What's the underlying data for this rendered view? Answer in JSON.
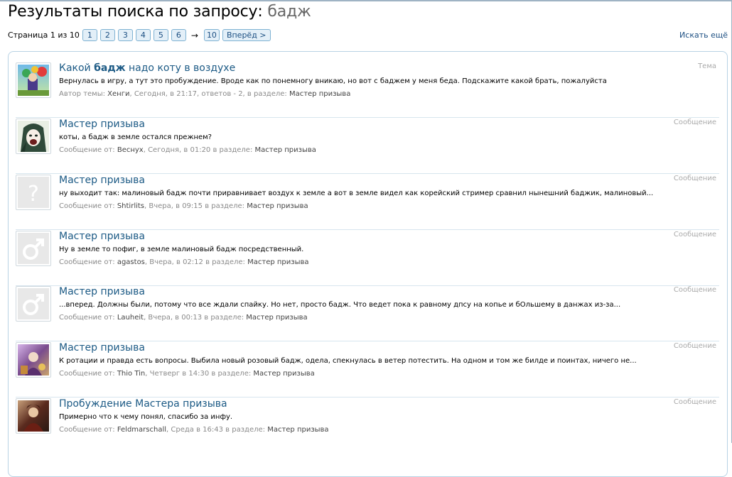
{
  "title": {
    "prefix": "Результаты поиска по запросу: ",
    "query": "бадж"
  },
  "pagination": {
    "info": "Страница 1 из 10",
    "pages": [
      "1",
      "2",
      "3",
      "4",
      "5",
      "6"
    ],
    "arrow": "→",
    "last": "10",
    "next": "Вперёд >"
  },
  "search_more": "Искать ещё",
  "results": [
    {
      "title_pre": "Какой ",
      "title_bold": "бадж",
      "title_post": " надо коту в воздухе",
      "snippet": "Вернулась в игру, а тут это пробуждение. Вроде как по понемногу вникаю, но вот с баджем у меня беда. Подскажите какой брать, пожалуйста",
      "meta_label": "Автор темы: ",
      "author": "Хенги",
      "meta_mid": ", Сегодня, в 21:17, ответов - 2, в разделе: ",
      "forum": "Мастер призыва",
      "type": "Тема",
      "avatar": "colorful-game-avatar"
    },
    {
      "title_pre": "Мастер призыва",
      "title_bold": "",
      "title_post": "",
      "snippet": "коты, а бадж в земле остался прежнем?",
      "meta_label": "Сообщение от: ",
      "author": "Веснух",
      "meta_mid": ", Сегодня, в 01:20 в разделе: ",
      "forum": "Мастер призыва",
      "type": "Сообщение",
      "avatar": "anime-avatar"
    },
    {
      "title_pre": "Мастер призыва",
      "title_bold": "",
      "title_post": "",
      "snippet": "ну выходит так: малиновый бадж почти приравнивает воздух к земле а вот в земле видел как корейский стример сравнил нынешний баджик, малиновый...",
      "meta_label": "Сообщение от: ",
      "author": "Shtirlits",
      "meta_mid": ", Вчера, в 09:15 в разделе: ",
      "forum": "Мастер призыва",
      "type": "Сообщение",
      "avatar": "question-avatar"
    },
    {
      "title_pre": "Мастер призыва",
      "title_bold": "",
      "title_post": "",
      "snippet": "Ну в земле то пофиг, в земле малиновый бадж посредственный.",
      "meta_label": "Сообщение от: ",
      "author": "agastos",
      "meta_mid": ", Вчера, в 02:12 в разделе: ",
      "forum": "Мастер призыва",
      "type": "Сообщение",
      "avatar": "male-avatar"
    },
    {
      "title_pre": "Мастер призыва",
      "title_bold": "",
      "title_post": "",
      "snippet": "...вперед. Должны были, потому что все ждали спайку. Но нет, просто бадж. Что ведет пока к равному дпсу на копье и бОльшему в данжах из-за...",
      "meta_label": "Сообщение от: ",
      "author": "Lauheit",
      "meta_mid": ", Вчера, в 00:13 в разделе: ",
      "forum": "Мастер призыва",
      "type": "Сообщение",
      "avatar": "male-avatar"
    },
    {
      "title_pre": "Мастер призыва",
      "title_bold": "",
      "title_post": "",
      "snippet": "К ротации и правда есть вопросы. Выбила новый розовый бадж, одела, спекнулась в ветер потестить. На одном и том же билде и поинтах, ничего не...",
      "meta_label": "Сообщение от: ",
      "author": "Thio Tin",
      "meta_mid": ", Четверг в 14:30 в разделе: ",
      "forum": "Мастер призыва",
      "type": "Сообщение",
      "avatar": "purple-art-avatar"
    },
    {
      "title_pre": "Пробуждение Мастера призыва",
      "title_bold": "",
      "title_post": "",
      "snippet": "Примерно что к чему понял, спасибо за инфу.",
      "meta_label": "Сообщение от: ",
      "author": "Feldmarschall",
      "meta_mid": ", Среда в 16:43 в разделе: ",
      "forum": "Мастер призыва",
      "type": "Сообщение",
      "avatar": "dark-character-avatar"
    }
  ]
}
